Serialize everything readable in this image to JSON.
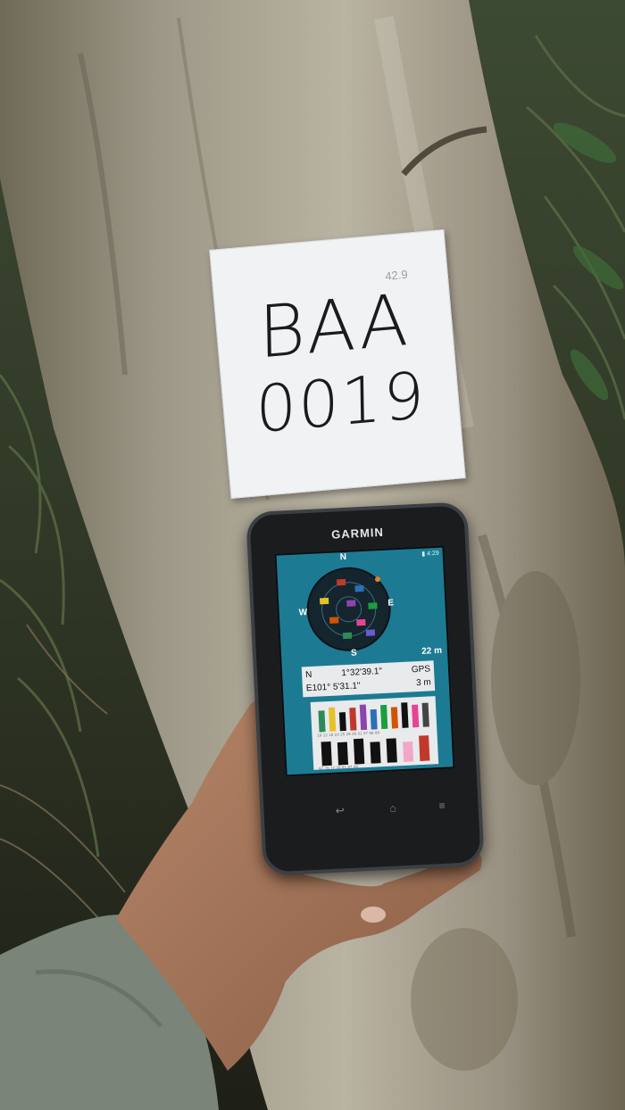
{
  "paper_tag": {
    "line1": "BAA",
    "line2": "0019",
    "corner_note": "42.9"
  },
  "device": {
    "brand": "GARMIN",
    "status_bar": "▮ 4:29",
    "sky_view": {
      "north_label": "N",
      "west_label": "W",
      "east_label": "E",
      "south_label": "S"
    },
    "accuracy": "22 m",
    "position": {
      "lat_hemisphere": "N",
      "lat_value": "1°32'39.1\"",
      "fix_label": "GPS",
      "lon_value": "E101° 5'31.1\"",
      "elevation": "3 m"
    },
    "signal_bars_top_ids": "10 12 18 23 25 26 29 31 37 65 66",
    "signal_bars_bottom_ids": "67 76 77 78 81 87 88",
    "signal_top": [
      0.8,
      0.9,
      0.7,
      0.85,
      0.95,
      0.75,
      0.9,
      0.8,
      0.95,
      0.85,
      0.9
    ],
    "signal_bottom": [
      0.9,
      0.85,
      0.95,
      0.8,
      0.9,
      0.75,
      0.95
    ],
    "signal_top_colors": [
      "#2e8b57",
      "#e6c229",
      "#111111",
      "#c0392b",
      "#8e44ad",
      "#2c6fb7",
      "#1b9e3e",
      "#d35400",
      "#111111",
      "#e84393",
      "#444444"
    ],
    "signal_bottom_colors": [
      "#111111",
      "#111111",
      "#111111",
      "#111111",
      "#111111",
      "#f2a7c8",
      "#c0392b"
    ]
  },
  "colors": {
    "screen": "#1d7a93",
    "bark": "#9a9585",
    "paper": "#f1f2f4",
    "device_body": "#1a1c1e"
  }
}
